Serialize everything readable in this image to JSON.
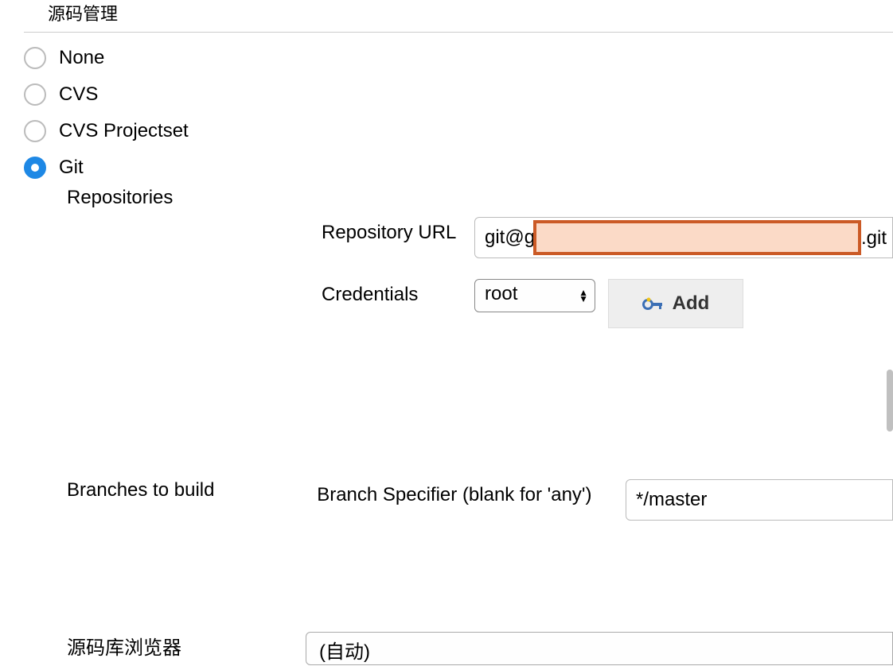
{
  "section_title": "源码管理",
  "scm_options": [
    {
      "label": "None",
      "selected": false
    },
    {
      "label": "CVS",
      "selected": false
    },
    {
      "label": "CVS Projectset",
      "selected": false
    },
    {
      "label": "Git",
      "selected": true
    }
  ],
  "git": {
    "repositories_label": "Repositories",
    "repo_url_label": "Repository URL",
    "repo_url_prefix": "git@g",
    "repo_url_suffix": ".git",
    "credentials_label": "Credentials",
    "credentials_value": "root",
    "add_button_label": "Add",
    "branches_heading": "Branches to build",
    "branch_specifier_label": "Branch Specifier (blank for 'any')",
    "branch_specifier_value": "*/master"
  },
  "browser_label": "源码库浏览器",
  "browser_value": "(自动)"
}
